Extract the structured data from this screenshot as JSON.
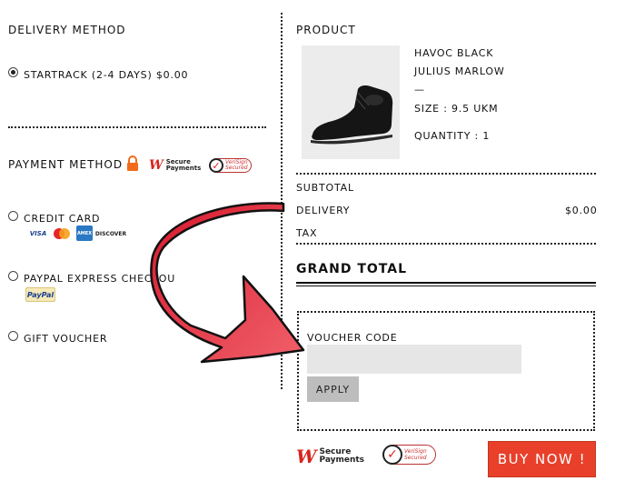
{
  "delivery": {
    "heading": "DELIVERY METHOD",
    "option_label": "STARTRACK (2-4 DAYS) $0.00"
  },
  "payment": {
    "heading": "PAYMENT METHOD",
    "secure_badge": {
      "brand": "W",
      "line1": "Secure",
      "line2": "Payments"
    },
    "verisign_badge": {
      "line1": "VeriSign",
      "line2": "Secured"
    },
    "options": [
      {
        "label": "CREDIT CARD",
        "cards": [
          "VISA",
          "MasterCard",
          "AMEX",
          "DISCOVER"
        ]
      },
      {
        "label": "PAYPAL EXPRESS CHECKOU",
        "badge": "PayPal"
      },
      {
        "label": "GIFT VOUCHER"
      }
    ]
  },
  "product": {
    "heading": "PRODUCT",
    "name_line1": "HAVOC BLACK",
    "name_line2": "JULIUS MARLOW",
    "dash": "—",
    "size": "SIZE : 9.5 UKM",
    "quantity": "QUANTITY : 1"
  },
  "summary": {
    "subtotal_label": "SUBTOTAL",
    "delivery_label": "DELIVERY",
    "delivery_value": "$0.00",
    "tax_label": "TAX",
    "grand_total_label": "GRAND TOTAL"
  },
  "voucher": {
    "label": "VOUCHER CODE",
    "input_value": "",
    "apply_label": "APPLY"
  },
  "footer": {
    "secure_badge": {
      "brand": "W",
      "line1": "Secure",
      "line2": "Payments"
    },
    "verisign_badge": {
      "line1": "VeriSign",
      "line2": "Secured"
    },
    "buy_label": "BUY NOW !"
  },
  "colors": {
    "accent_red": "#e8402a",
    "arrow_red": "#e8283a",
    "westpac_red": "#d8241c",
    "lock_orange": "#f26a1b"
  },
  "icons": [
    "lock-icon",
    "curved-arrow-icon",
    "shoe-image",
    "verisign-check-icon"
  ]
}
